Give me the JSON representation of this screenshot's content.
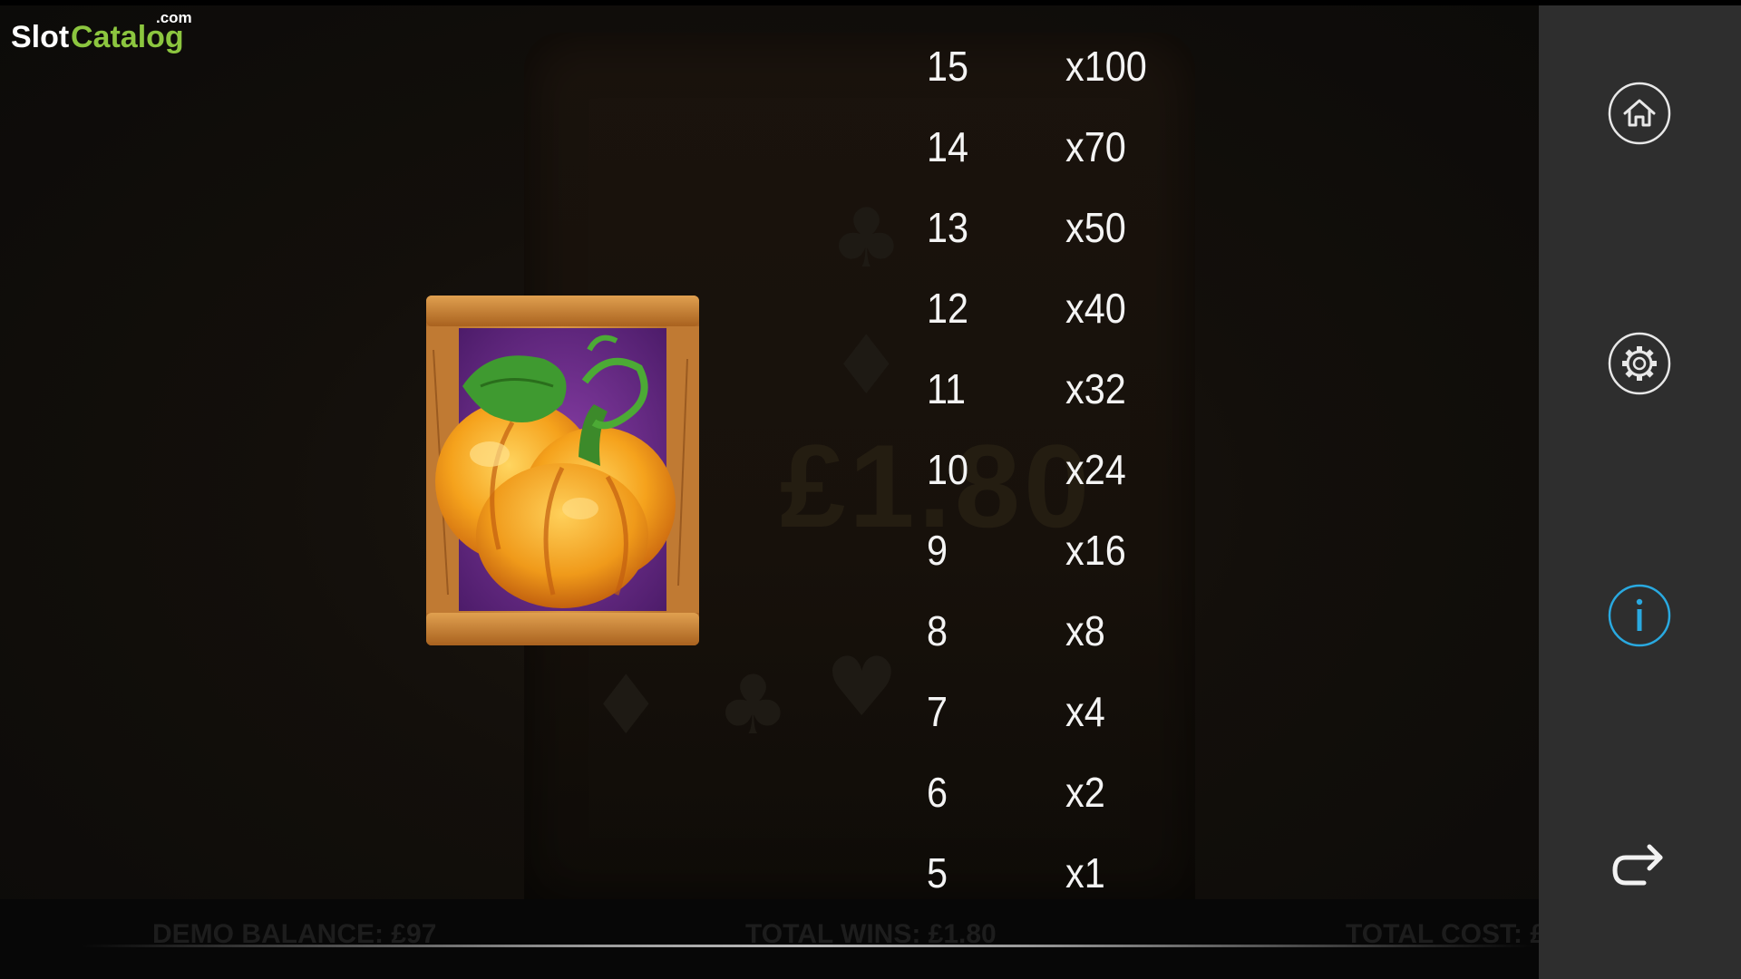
{
  "logo": {
    "slot": "Slot",
    "catalog": "Catalog",
    "com": ".com"
  },
  "symbol": {
    "name": "pumpkin-icon"
  },
  "paytable": {
    "rows": [
      {
        "count": "15",
        "multiplier": "x100"
      },
      {
        "count": "14",
        "multiplier": "x70"
      },
      {
        "count": "13",
        "multiplier": "x50"
      },
      {
        "count": "12",
        "multiplier": "x40"
      },
      {
        "count": "11",
        "multiplier": "x32"
      },
      {
        "count": "10",
        "multiplier": "x24"
      },
      {
        "count": "9",
        "multiplier": "x16"
      },
      {
        "count": "8",
        "multiplier": "x8"
      },
      {
        "count": "7",
        "multiplier": "x4"
      },
      {
        "count": "6",
        "multiplier": "x2"
      },
      {
        "count": "5",
        "multiplier": "x1"
      }
    ]
  },
  "background": {
    "amount": "£1.80"
  },
  "bottom_bar": {
    "balance": "DEMO BALANCE: £97",
    "wins": "TOTAL WINS: £1.80",
    "cost": "TOTAL COST: £"
  },
  "side_panel": {
    "home_icon": "home-icon",
    "settings_icon": "gear-icon",
    "info_icon": "info-icon",
    "back_icon": "return-arrow-icon",
    "info_color": "#29a9e0"
  },
  "colors": {
    "logo_green": "#8cc63f",
    "panel": "#2e2e2e",
    "text": "#f4f4f4"
  }
}
